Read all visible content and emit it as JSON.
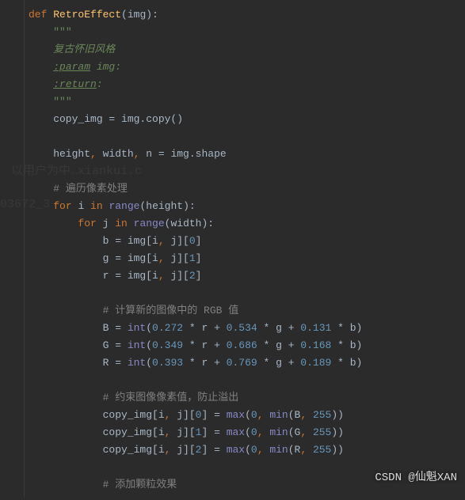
{
  "chart_data": {
    "type": "table",
    "title": "RetroEffect Python function (syntax-highlighted code)",
    "lines": [
      {
        "indent": 0,
        "tokens": [
          {
            "t": "kw",
            "v": "def "
          },
          {
            "t": "fn",
            "v": "RetroEffect"
          },
          {
            "t": "",
            "v": "("
          },
          {
            "t": "",
            "v": "img"
          },
          {
            "t": "",
            "v": ")"
          },
          {
            "t": "",
            "v": ":"
          }
        ]
      },
      {
        "indent": 1,
        "tokens": [
          {
            "t": "str",
            "v": "\"\"\""
          }
        ]
      },
      {
        "indent": 1,
        "tokens": [
          {
            "t": "docstr",
            "v": "复古怀旧风格"
          }
        ]
      },
      {
        "indent": 1,
        "tokens": [
          {
            "t": "doctag",
            "v": ":param"
          },
          {
            "t": "docstr",
            "v": " img:"
          }
        ]
      },
      {
        "indent": 1,
        "tokens": [
          {
            "t": "doctag",
            "v": ":return"
          },
          {
            "t": "docstr",
            "v": ":"
          }
        ]
      },
      {
        "indent": 1,
        "tokens": [
          {
            "t": "str",
            "v": "\"\"\""
          }
        ]
      },
      {
        "indent": 1,
        "tokens": [
          {
            "t": "",
            "v": "copy_img = img.copy()"
          }
        ]
      },
      {
        "indent": 0,
        "tokens": [
          {
            "t": "",
            "v": ""
          }
        ]
      },
      {
        "indent": 1,
        "tokens": [
          {
            "t": "",
            "v": "height"
          },
          {
            "t": "op",
            "v": ", "
          },
          {
            "t": "",
            "v": "width"
          },
          {
            "t": "op",
            "v": ", "
          },
          {
            "t": "",
            "v": "n = img.shape"
          }
        ]
      },
      {
        "indent": 0,
        "tokens": [
          {
            "t": "",
            "v": ""
          }
        ]
      },
      {
        "indent": 1,
        "tokens": [
          {
            "t": "cmt",
            "v": "# 遍历像素处理"
          }
        ]
      },
      {
        "indent": 1,
        "tokens": [
          {
            "t": "kw",
            "v": "for "
          },
          {
            "t": "",
            "v": "i "
          },
          {
            "t": "kw",
            "v": "in "
          },
          {
            "t": "builtin",
            "v": "range"
          },
          {
            "t": "",
            "v": "(height):"
          }
        ]
      },
      {
        "indent": 2,
        "tokens": [
          {
            "t": "kw",
            "v": "for "
          },
          {
            "t": "",
            "v": "j "
          },
          {
            "t": "kw",
            "v": "in "
          },
          {
            "t": "builtin",
            "v": "range"
          },
          {
            "t": "",
            "v": "(width):"
          }
        ]
      },
      {
        "indent": 3,
        "tokens": [
          {
            "t": "",
            "v": "b = img[i"
          },
          {
            "t": "op",
            "v": ", "
          },
          {
            "t": "",
            "v": "j]["
          },
          {
            "t": "num",
            "v": "0"
          },
          {
            "t": "",
            "v": "]"
          }
        ]
      },
      {
        "indent": 3,
        "tokens": [
          {
            "t": "",
            "v": "g = img[i"
          },
          {
            "t": "op",
            "v": ", "
          },
          {
            "t": "",
            "v": "j]["
          },
          {
            "t": "num",
            "v": "1"
          },
          {
            "t": "",
            "v": "]"
          }
        ]
      },
      {
        "indent": 3,
        "tokens": [
          {
            "t": "",
            "v": "r = img[i"
          },
          {
            "t": "op",
            "v": ", "
          },
          {
            "t": "",
            "v": "j]["
          },
          {
            "t": "num",
            "v": "2"
          },
          {
            "t": "",
            "v": "]"
          }
        ]
      },
      {
        "indent": 0,
        "tokens": [
          {
            "t": "",
            "v": ""
          }
        ]
      },
      {
        "indent": 3,
        "tokens": [
          {
            "t": "cmt",
            "v": "# 计算新的图像中的 RGB 值"
          }
        ]
      },
      {
        "indent": 3,
        "tokens": [
          {
            "t": "",
            "v": "B = "
          },
          {
            "t": "builtin",
            "v": "int"
          },
          {
            "t": "",
            "v": "("
          },
          {
            "t": "num",
            "v": "0.272"
          },
          {
            "t": "",
            "v": " * r + "
          },
          {
            "t": "num",
            "v": "0.534"
          },
          {
            "t": "",
            "v": " * g + "
          },
          {
            "t": "num",
            "v": "0.131"
          },
          {
            "t": "",
            "v": " * b)"
          }
        ]
      },
      {
        "indent": 3,
        "tokens": [
          {
            "t": "",
            "v": "G = "
          },
          {
            "t": "builtin",
            "v": "int"
          },
          {
            "t": "",
            "v": "("
          },
          {
            "t": "num",
            "v": "0.349"
          },
          {
            "t": "",
            "v": " * r + "
          },
          {
            "t": "num",
            "v": "0.686"
          },
          {
            "t": "",
            "v": " * g + "
          },
          {
            "t": "num",
            "v": "0.168"
          },
          {
            "t": "",
            "v": " * b)"
          }
        ]
      },
      {
        "indent": 3,
        "tokens": [
          {
            "t": "",
            "v": "R = "
          },
          {
            "t": "builtin",
            "v": "int"
          },
          {
            "t": "",
            "v": "("
          },
          {
            "t": "num",
            "v": "0.393"
          },
          {
            "t": "",
            "v": " * r + "
          },
          {
            "t": "num",
            "v": "0.769"
          },
          {
            "t": "",
            "v": " * g + "
          },
          {
            "t": "num",
            "v": "0.189"
          },
          {
            "t": "",
            "v": " * b)"
          }
        ]
      },
      {
        "indent": 0,
        "tokens": [
          {
            "t": "",
            "v": ""
          }
        ]
      },
      {
        "indent": 3,
        "tokens": [
          {
            "t": "cmt",
            "v": "# 约束图像像素值，防止溢出"
          }
        ]
      },
      {
        "indent": 3,
        "tokens": [
          {
            "t": "",
            "v": "copy_img[i"
          },
          {
            "t": "op",
            "v": ", "
          },
          {
            "t": "",
            "v": "j]["
          },
          {
            "t": "num",
            "v": "0"
          },
          {
            "t": "",
            "v": "] = "
          },
          {
            "t": "builtin",
            "v": "max"
          },
          {
            "t": "",
            "v": "("
          },
          {
            "t": "num",
            "v": "0"
          },
          {
            "t": "op",
            "v": ", "
          },
          {
            "t": "builtin",
            "v": "min"
          },
          {
            "t": "",
            "v": "(B"
          },
          {
            "t": "op",
            "v": ", "
          },
          {
            "t": "num",
            "v": "255"
          },
          {
            "t": "",
            "v": "))"
          }
        ]
      },
      {
        "indent": 3,
        "tokens": [
          {
            "t": "",
            "v": "copy_img[i"
          },
          {
            "t": "op",
            "v": ", "
          },
          {
            "t": "",
            "v": "j]["
          },
          {
            "t": "num",
            "v": "1"
          },
          {
            "t": "",
            "v": "] = "
          },
          {
            "t": "builtin",
            "v": "max"
          },
          {
            "t": "",
            "v": "("
          },
          {
            "t": "num",
            "v": "0"
          },
          {
            "t": "op",
            "v": ", "
          },
          {
            "t": "builtin",
            "v": "min"
          },
          {
            "t": "",
            "v": "(G"
          },
          {
            "t": "op",
            "v": ", "
          },
          {
            "t": "num",
            "v": "255"
          },
          {
            "t": "",
            "v": "))"
          }
        ]
      },
      {
        "indent": 3,
        "tokens": [
          {
            "t": "",
            "v": "copy_img[i"
          },
          {
            "t": "op",
            "v": ", "
          },
          {
            "t": "",
            "v": "j]["
          },
          {
            "t": "num",
            "v": "2"
          },
          {
            "t": "",
            "v": "] = "
          },
          {
            "t": "builtin",
            "v": "max"
          },
          {
            "t": "",
            "v": "("
          },
          {
            "t": "num",
            "v": "0"
          },
          {
            "t": "op",
            "v": ", "
          },
          {
            "t": "builtin",
            "v": "min"
          },
          {
            "t": "",
            "v": "(R"
          },
          {
            "t": "op",
            "v": ", "
          },
          {
            "t": "num",
            "v": "255"
          },
          {
            "t": "",
            "v": "))"
          }
        ]
      },
      {
        "indent": 0,
        "tokens": [
          {
            "t": "",
            "v": ""
          }
        ]
      },
      {
        "indent": 3,
        "tokens": [
          {
            "t": "cmt",
            "v": "# 添加颗粒效果"
          }
        ]
      }
    ]
  },
  "watermarks": {
    "w1": "以用户为中…xiankui.c",
    "w2": "03672_3"
  },
  "attribution": "CSDN @仙魁XAN"
}
